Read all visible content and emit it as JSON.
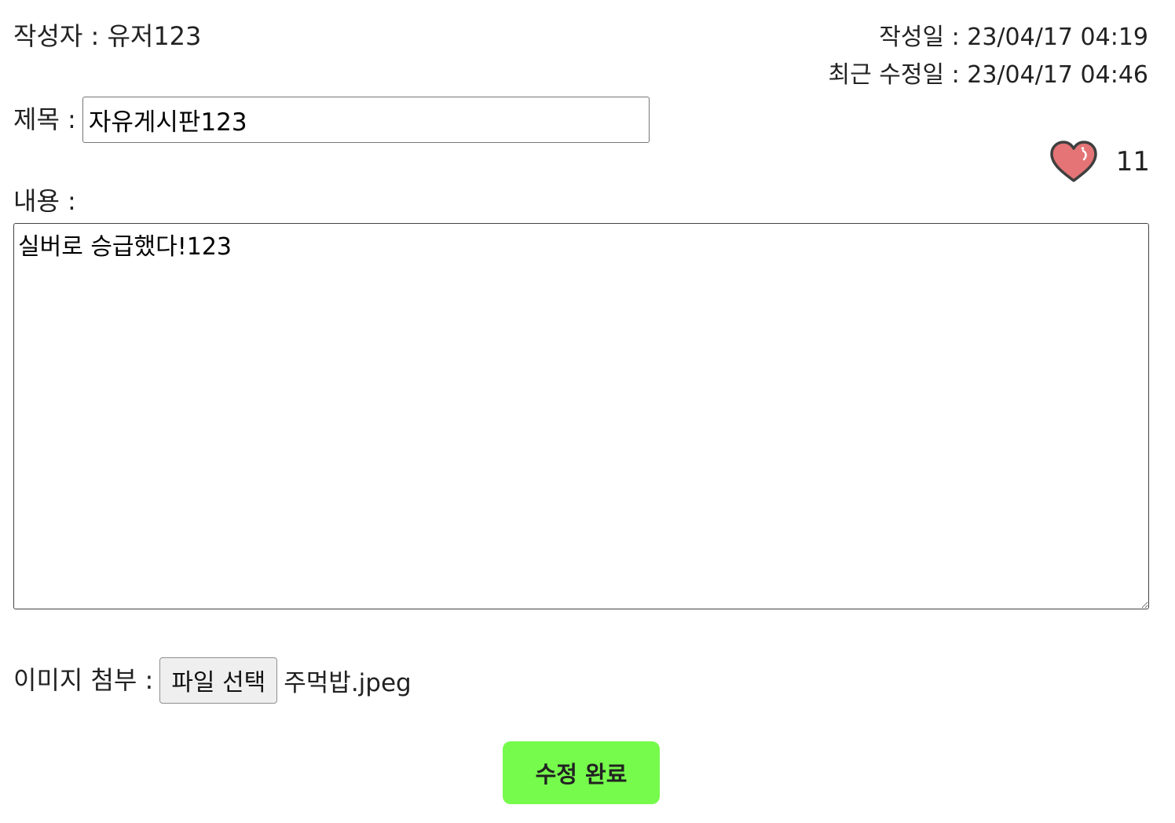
{
  "author": {
    "text": "작성자 : 유저123"
  },
  "dates": {
    "created": "작성일 : 23/04/17 04:19",
    "modified": "최근 수정일 : 23/04/17 04:46"
  },
  "title": {
    "label": "제목 :",
    "value": "자유게시판123"
  },
  "likes": {
    "icon": "heart-icon",
    "count": "11",
    "color": "#e47475"
  },
  "content": {
    "label": "내용 :",
    "value": "실버로 승급했다!123"
  },
  "attachment": {
    "label": "이미지 첨부 :",
    "button_label": "파일 선택",
    "file_name": "주먹밥.jpeg"
  },
  "submit": {
    "label": "수정 완료",
    "color": "#76fb4c"
  }
}
